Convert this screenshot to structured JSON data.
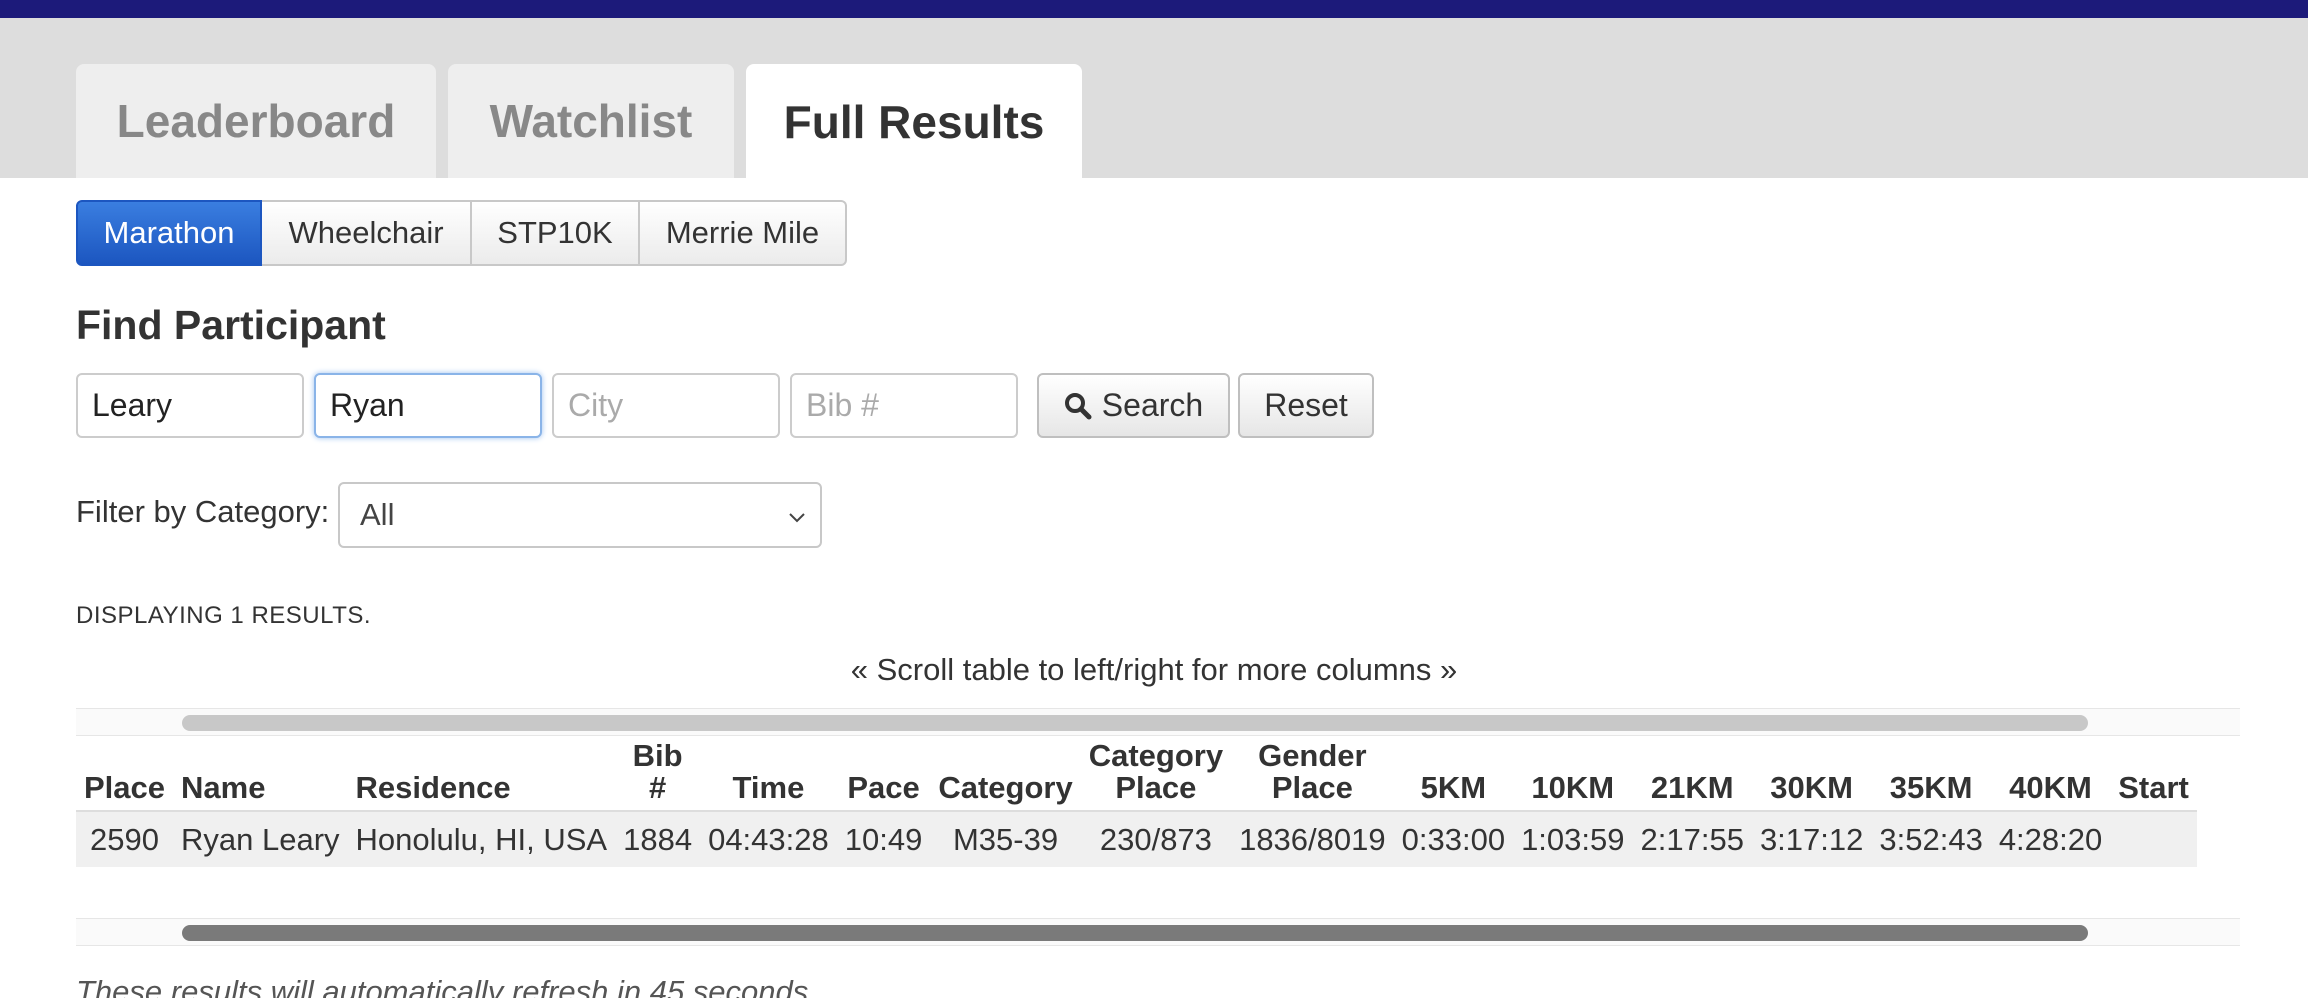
{
  "tabs": [
    {
      "label": "Leaderboard",
      "active": false
    },
    {
      "label": "Watchlist",
      "active": false
    },
    {
      "label": "Full Results",
      "active": true
    }
  ],
  "race_types": [
    {
      "label": "Marathon",
      "active": true
    },
    {
      "label": "Wheelchair",
      "active": false
    },
    {
      "label": "STP10K",
      "active": false
    },
    {
      "label": "Merrie Mile",
      "active": false
    }
  ],
  "find": {
    "title": "Find Participant",
    "last_name": {
      "value": "Leary",
      "placeholder": ""
    },
    "first_name": {
      "value": "Ryan",
      "placeholder": ""
    },
    "city": {
      "value": "",
      "placeholder": "City"
    },
    "bib": {
      "value": "",
      "placeholder": "Bib #"
    },
    "search_label": "Search",
    "reset_label": "Reset"
  },
  "filter": {
    "label": "Filter by Category:",
    "selected": "All"
  },
  "results_count": "DISPLAYING 1 RESULTS.",
  "scroll_hint": "« Scroll table to left/right for more columns »",
  "table": {
    "headers": {
      "place": "Place",
      "name": "Name",
      "residence": "Residence",
      "bib_1": "Bib",
      "bib_2": "#",
      "time": "Time",
      "pace": "Pace",
      "category": "Category",
      "category_place_1": "Category",
      "category_place_2": "Place",
      "gender_place_1": "Gender",
      "gender_place_2": "Place",
      "k5": "5KM",
      "k10": "10KM",
      "k21": "21KM",
      "k30": "30KM",
      "k35": "35KM",
      "k40": "40KM",
      "start": "Start"
    },
    "rows": [
      {
        "place": "2590",
        "name": "Ryan Leary",
        "residence": "Honolulu, HI, USA",
        "bib": "1884",
        "time": "04:43:28",
        "pace": "10:49",
        "category": "M35-39",
        "category_place": "230/873",
        "gender_place": "1836/8019",
        "k5": "0:33:00",
        "k10": "1:03:59",
        "k21": "2:17:55",
        "k30": "3:17:12",
        "k35": "3:52:43",
        "k40": "4:28:20"
      }
    ]
  },
  "refresh_note": "These results will automatically refresh in 45 seconds",
  "colors": {
    "topbar": "#1c1a7a",
    "active_button": "#1c56c0",
    "tab_strip": "#dddddd"
  }
}
